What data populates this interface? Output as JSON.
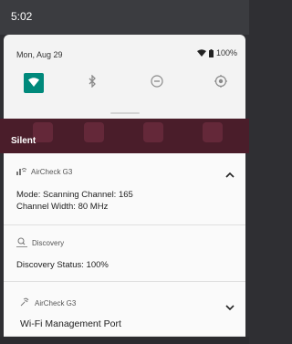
{
  "status_bar": {
    "time": "5:02"
  },
  "quick_settings": {
    "date": "Mon, Aug 29",
    "battery": "100%",
    "tiles": [
      {
        "icon": "wifi-icon",
        "active": true
      },
      {
        "icon": "bluetooth-icon",
        "active": false
      },
      {
        "icon": "do-not-disturb-icon",
        "active": false
      },
      {
        "icon": "location-icon",
        "active": false
      }
    ],
    "accent_color": "#00897b"
  },
  "silent_section": {
    "label": "Silent"
  },
  "notifications": [
    {
      "app": "AirCheck G3",
      "icon": "aircheck-icon",
      "lines": [
        "Mode: Scanning Channel: 165",
        "Channel Width: 80 MHz"
      ],
      "expanded": true
    },
    {
      "app": "Discovery",
      "icon": "discovery-icon",
      "lines": [
        "Discovery Status: 100%"
      ],
      "expanded": true
    },
    {
      "app": "AirCheck G3",
      "icon": "aircheck-icon",
      "lines": [
        "Wi-Fi Management Port"
      ],
      "expanded": false
    }
  ]
}
